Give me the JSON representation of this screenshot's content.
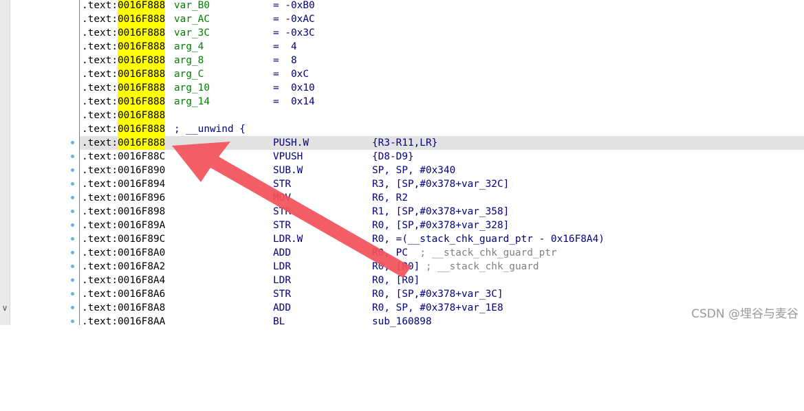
{
  "scroll": {
    "down_icon": "chevron-down-icon",
    "glyph": "∨"
  },
  "header_lines": [
    {
      "prefix": ".text:",
      "addr": "0016F888",
      "name": "var_B0",
      "value": "= -0xB0"
    },
    {
      "prefix": ".text:",
      "addr": "0016F888",
      "name": "var_AC",
      "value": "= -0xAC"
    },
    {
      "prefix": ".text:",
      "addr": "0016F888",
      "name": "var_3C",
      "value": "= -0x3C"
    },
    {
      "prefix": ".text:",
      "addr": "0016F888",
      "name": "arg_4",
      "value": "=  4"
    },
    {
      "prefix": ".text:",
      "addr": "0016F888",
      "name": "arg_8",
      "value": "=  8"
    },
    {
      "prefix": ".text:",
      "addr": "0016F888",
      "name": "arg_C",
      "value": "=  0xC"
    },
    {
      "prefix": ".text:",
      "addr": "0016F888",
      "name": "arg_10",
      "value": "=  0x10"
    },
    {
      "prefix": ".text:",
      "addr": "0016F888",
      "name": "arg_14",
      "value": "=  0x14"
    },
    {
      "prefix": ".text:",
      "addr": "0016F888",
      "name": "",
      "value": ""
    },
    {
      "prefix": ".text:",
      "addr": "0016F888",
      "comment": "; __unwind {"
    }
  ],
  "instructions": [
    {
      "prefix": ".text:",
      "addr": "0016F888",
      "mnem": "PUSH.W",
      "ops": "{R3-R11,LR}",
      "current": true
    },
    {
      "prefix": ".text:",
      "addr": "0016F88C",
      "mnem": "VPUSH",
      "ops": "{D8-D9}"
    },
    {
      "prefix": ".text:",
      "addr": "0016F890",
      "mnem": "SUB.W",
      "ops": "SP, SP, #0x340"
    },
    {
      "prefix": ".text:",
      "addr": "0016F894",
      "mnem": "STR",
      "ops": "R3, [SP,#0x378+var_32C]"
    },
    {
      "prefix": ".text:",
      "addr": "0016F896",
      "mnem": "MOV",
      "ops": "R6, R2"
    },
    {
      "prefix": ".text:",
      "addr": "0016F898",
      "mnem": "STR",
      "ops": "R1, [SP,#0x378+var_358]"
    },
    {
      "prefix": ".text:",
      "addr": "0016F89A",
      "mnem": "STR",
      "ops": "R0, [SP,#0x378+var_328]"
    },
    {
      "prefix": ".text:",
      "addr": "0016F89C",
      "mnem": "LDR.W",
      "ops": "R0, =(__stack_chk_guard_ptr - 0x16F8A4)"
    },
    {
      "prefix": ".text:",
      "addr": "0016F8A0",
      "mnem": "ADD",
      "ops": "R0, PC  ",
      "comment": "; __stack_chk_guard_ptr"
    },
    {
      "prefix": ".text:",
      "addr": "0016F8A2",
      "mnem": "LDR",
      "ops": "R0, [R0] ",
      "comment": "; __stack_chk_guard"
    },
    {
      "prefix": ".text:",
      "addr": "0016F8A4",
      "mnem": "LDR",
      "ops": "R0, [R0]"
    },
    {
      "prefix": ".text:",
      "addr": "0016F8A6",
      "mnem": "STR",
      "ops": "R0, [SP,#0x378+var_3C]"
    },
    {
      "prefix": ".text:",
      "addr": "0016F8A8",
      "mnem": "ADD",
      "ops": "R0, SP, #0x378+var_1E8"
    },
    {
      "prefix": ".text:",
      "addr": "0016F8AA",
      "mnem": "BL",
      "ops": "sub_160898"
    }
  ],
  "watermark": "CSDN @埋谷与麦谷",
  "colors": {
    "address_highlight": "#ffff00",
    "current_line": "#e2e2e2",
    "symbol": "#008000",
    "instruction": "#000080",
    "breakpoint_dot": "#5fb4e6",
    "arrow": "#f2505a"
  }
}
